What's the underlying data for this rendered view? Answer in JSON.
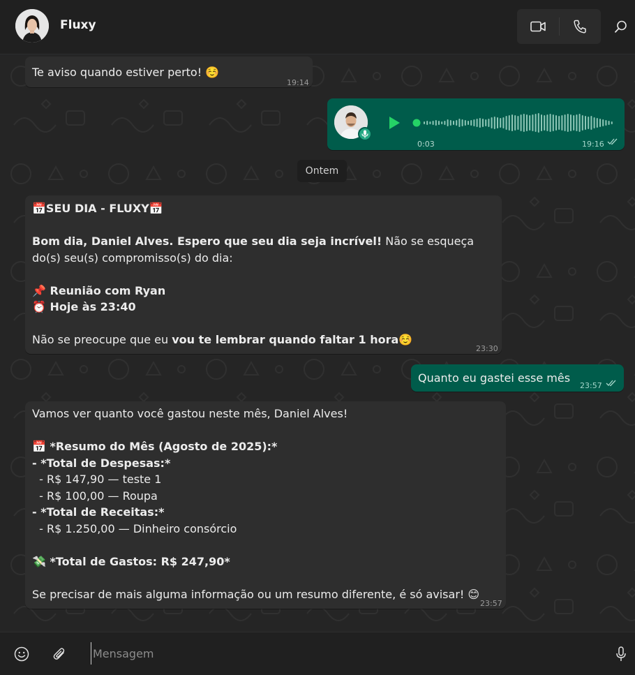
{
  "header": {
    "contact_name": "Fluxy",
    "video_icon": "video-camera-icon",
    "call_icon": "phone-icon",
    "search_icon": "search-icon"
  },
  "messages": {
    "m1": {
      "text": "Te aviso quando estiver perto! ☺️",
      "time": "19:14"
    },
    "voice": {
      "duration": "0:03",
      "time": "19:16",
      "play_icon": "play-icon",
      "mic_icon": "microphone-icon"
    },
    "date_separator": "Ontem",
    "m2": {
      "title": "📅SEU DIA - FLUXY📅",
      "greeting_bold": "Bom dia, Daniel Alves. Espero que seu dia seja incrível!",
      "greeting_rest": " Não se esqueça do(s) seu(s) compromisso(s) do dia:",
      "appointment": "📌 Reunião com Ryan",
      "when": "⏰ Hoje às 23:40",
      "reminder_start": "Não se preocupe que eu ",
      "reminder_bold": "vou te lembrar quando faltar 1 hora",
      "reminder_emoji": "☺️",
      "time": "23:30"
    },
    "m3": {
      "text": "Quanto eu gastei esse mês",
      "time": "23:57"
    },
    "m4": {
      "intro": "Vamos ver quanto você gastou neste mês, Daniel Alves!",
      "summary_title": "📅 *Resumo do Mês (Agosto de 2025):*",
      "expenses_title": "- *Total de Despesas:*",
      "expense_1": "  - R$ 147,90 — teste 1",
      "expense_2": "  - R$ 100,00 — Roupa",
      "income_title": "- *Total de Receitas:*",
      "income_1": "  - R$ 1.250,00 — Dinheiro consórcio",
      "total": "💸 *Total de Gastos: R$ 247,90*",
      "closing": "Se precisar de mais alguma informação ou um resumo diferente, é só avisar! 😊",
      "time": "23:57"
    }
  },
  "composer": {
    "placeholder": "Mensagem",
    "emoji_icon": "smiley-icon",
    "attach_icon": "paperclip-icon",
    "mic_icon": "microphone-icon"
  },
  "colors": {
    "incoming_bubble": "#2e2e2e",
    "outgoing_bubble": "#005c4b",
    "accent_green": "#25d366"
  }
}
